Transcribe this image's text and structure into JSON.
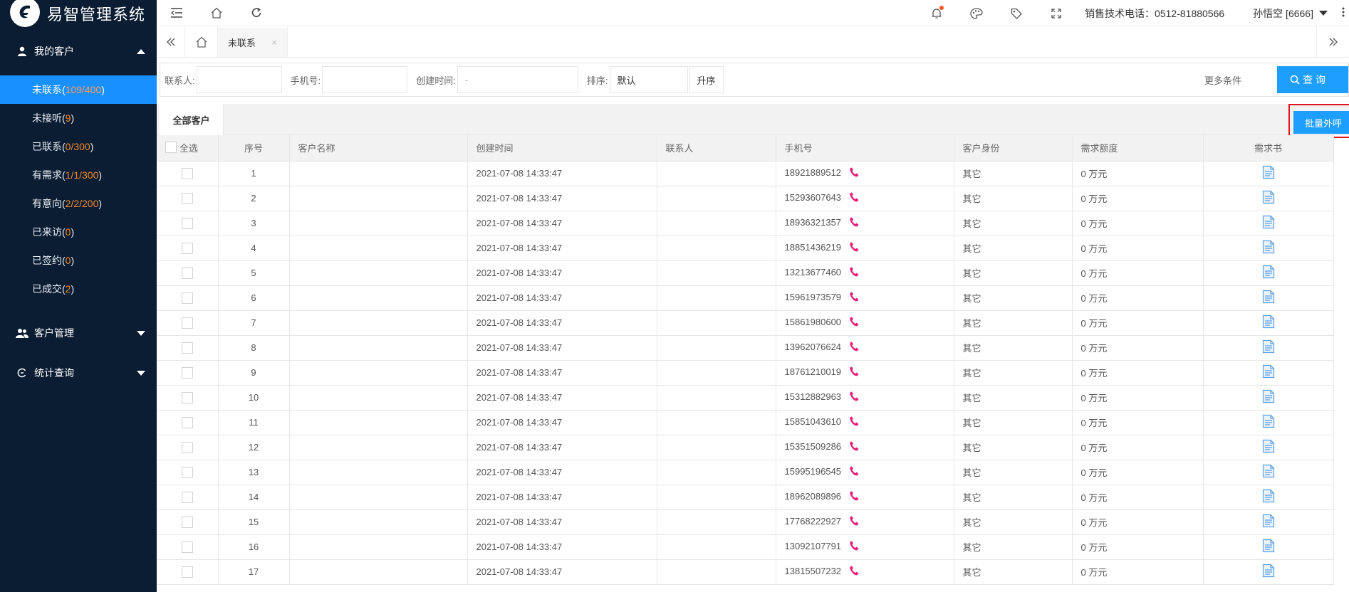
{
  "app": {
    "title": "易智管理系统"
  },
  "sidebar": {
    "group_my": {
      "label": "我的客户"
    },
    "items": [
      {
        "label": "未联系(",
        "count": "109/400",
        "tail": ")"
      },
      {
        "label": "未接听(",
        "count": "9",
        "tail": ")"
      },
      {
        "label": "已联系(",
        "count": "0/300",
        "tail": ")"
      },
      {
        "label": "有需求(",
        "count": "1/1/300",
        "tail": ")"
      },
      {
        "label": "有意向(",
        "count": "2/2/200",
        "tail": ")"
      },
      {
        "label": "已来访(",
        "count": "0",
        "tail": ")"
      },
      {
        "label": "已签约(",
        "count": "0",
        "tail": ")"
      },
      {
        "label": "已成交(",
        "count": "2",
        "tail": ")"
      }
    ],
    "group_manage": {
      "label": "客户管理"
    },
    "group_stats": {
      "label": "统计查询"
    }
  },
  "header": {
    "sales_phone": "销售技术电话：0512-81880566",
    "user": "孙悟空 [6666]"
  },
  "tabs": {
    "active": {
      "label": "未联系",
      "close": "×"
    }
  },
  "filter": {
    "contact_label": "联系人:",
    "contact_value": "",
    "phone_label": "手机号:",
    "phone_value": "",
    "created_label": "创建时间:",
    "created_placeholder": "-",
    "sort_label": "排序:",
    "sort_value": "默认",
    "order_button": "升序",
    "more_conditions": "更多条件",
    "query_button": "查 询"
  },
  "section": {
    "tab_all": "全部客户",
    "batch_call": "批量外呼"
  },
  "table": {
    "headers": {
      "select_all": "全选",
      "index": "序号",
      "name": "客户名称",
      "created": "创建时间",
      "contact": "联系人",
      "phone": "手机号",
      "identity": "客户身份",
      "amount": "需求额度",
      "doc": "需求书"
    },
    "rows": [
      {
        "index": "1",
        "name": "",
        "created": "2021-07-08 14:33:47",
        "contact": "",
        "phone": "18921889512",
        "identity": "其它",
        "amount": "0 万元"
      },
      {
        "index": "2",
        "name": "",
        "created": "2021-07-08 14:33:47",
        "contact": "",
        "phone": "15293607643",
        "identity": "其它",
        "amount": "0 万元"
      },
      {
        "index": "3",
        "name": "",
        "created": "2021-07-08 14:33:47",
        "contact": "",
        "phone": "18936321357",
        "identity": "其它",
        "amount": "0 万元"
      },
      {
        "index": "4",
        "name": "",
        "created": "2021-07-08 14:33:47",
        "contact": "",
        "phone": "18851436219",
        "identity": "其它",
        "amount": "0 万元"
      },
      {
        "index": "5",
        "name": "",
        "created": "2021-07-08 14:33:47",
        "contact": "",
        "phone": "13213677460",
        "identity": "其它",
        "amount": "0 万元"
      },
      {
        "index": "6",
        "name": "",
        "created": "2021-07-08 14:33:47",
        "contact": "",
        "phone": "15961973579",
        "identity": "其它",
        "amount": "0 万元"
      },
      {
        "index": "7",
        "name": "",
        "created": "2021-07-08 14:33:47",
        "contact": "",
        "phone": "15861980600",
        "identity": "其它",
        "amount": "0 万元"
      },
      {
        "index": "8",
        "name": "",
        "created": "2021-07-08 14:33:47",
        "contact": "",
        "phone": "13962076624",
        "identity": "其它",
        "amount": "0 万元"
      },
      {
        "index": "9",
        "name": "",
        "created": "2021-07-08 14:33:47",
        "contact": "",
        "phone": "18761210019",
        "identity": "其它",
        "amount": "0 万元"
      },
      {
        "index": "10",
        "name": "",
        "created": "2021-07-08 14:33:47",
        "contact": "",
        "phone": "15312882963",
        "identity": "其它",
        "amount": "0 万元"
      },
      {
        "index": "11",
        "name": "",
        "created": "2021-07-08 14:33:47",
        "contact": "",
        "phone": "15851043610",
        "identity": "其它",
        "amount": "0 万元"
      },
      {
        "index": "12",
        "name": "",
        "created": "2021-07-08 14:33:47",
        "contact": "",
        "phone": "15351509286",
        "identity": "其它",
        "amount": "0 万元"
      },
      {
        "index": "13",
        "name": "",
        "created": "2021-07-08 14:33:47",
        "contact": "",
        "phone": "15995196545",
        "identity": "其它",
        "amount": "0 万元"
      },
      {
        "index": "14",
        "name": "",
        "created": "2021-07-08 14:33:47",
        "contact": "",
        "phone": "18962089896",
        "identity": "其它",
        "amount": "0 万元"
      },
      {
        "index": "15",
        "name": "",
        "created": "2021-07-08 14:33:47",
        "contact": "",
        "phone": "17768222927",
        "identity": "其它",
        "amount": "0 万元"
      },
      {
        "index": "16",
        "name": "",
        "created": "2021-07-08 14:33:47",
        "contact": "",
        "phone": "13092107791",
        "identity": "其它",
        "amount": "0 万元"
      },
      {
        "index": "17",
        "name": "",
        "created": "2021-07-08 14:33:47",
        "contact": "",
        "phone": "13815507232",
        "identity": "其它",
        "amount": "0 万元"
      }
    ]
  },
  "colors": {
    "sidebar_bg": "#0b1d33",
    "accent": "#1e9fff",
    "active_item": "#1890ff",
    "count_orange": "#f28c28",
    "call_icon": "#e8207a",
    "highlight_border": "#e0141c"
  },
  "icons": {
    "logo": "logo-mark-icon",
    "header": [
      "menu-fold-icon",
      "home-icon",
      "refresh-icon",
      "bell-icon",
      "palette-icon",
      "tag-icon",
      "fullscreen-icon"
    ],
    "row_phone": "phone-call-icon",
    "row_doc": "document-icon"
  }
}
